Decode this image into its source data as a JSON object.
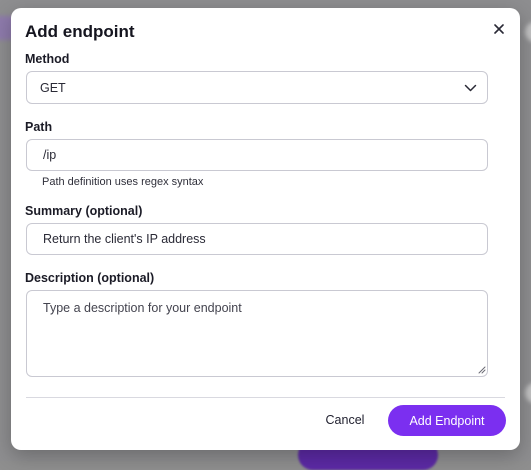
{
  "dialog": {
    "title": "Add endpoint",
    "close_icon": "close-icon"
  },
  "method": {
    "label": "Method",
    "value": "GET",
    "icon": "chevron-down-icon"
  },
  "path": {
    "label": "Path",
    "value": "/ip",
    "helper": "Path definition uses regex syntax"
  },
  "summary": {
    "label": "Summary (optional)",
    "value": "Return the client's IP address"
  },
  "description": {
    "label": "Description (optional)",
    "value": "",
    "placeholder": "Type a description for your endpoint"
  },
  "actions": {
    "cancel_label": "Cancel",
    "submit_label": "Add Endpoint"
  },
  "colors": {
    "primary": "#7b2ff0",
    "overlay": "#8e8e90"
  }
}
